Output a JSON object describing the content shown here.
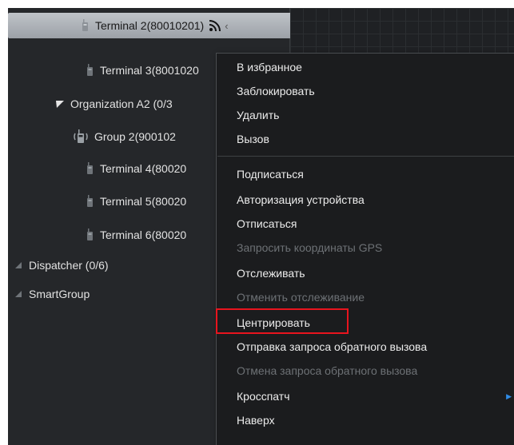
{
  "tree": {
    "items": [
      {
        "label": "Terminal 2(80010201)",
        "type": "terminal",
        "selected": true
      },
      {
        "label": "Terminal 3(8001020",
        "type": "terminal"
      },
      {
        "label": "Organization A2 (0/3",
        "type": "organization",
        "expanded": true
      },
      {
        "label": "Group 2(900102",
        "type": "group"
      },
      {
        "label": "Terminal 4(80020",
        "type": "terminal"
      },
      {
        "label": "Terminal 5(80020",
        "type": "terminal"
      },
      {
        "label": "Terminal 6(80020",
        "type": "terminal"
      },
      {
        "label": "Dispatcher (0/6)",
        "type": "folder"
      },
      {
        "label": "SmartGroup",
        "type": "folder"
      }
    ]
  },
  "context_menu": {
    "items": [
      {
        "label": "В избранное",
        "enabled": true
      },
      {
        "label": "Заблокировать",
        "enabled": true
      },
      {
        "label": "Удалить",
        "enabled": true
      },
      {
        "label": "Вызов",
        "enabled": true
      },
      {
        "label": "Подписаться",
        "enabled": true
      },
      {
        "label": "Авторизация устройства",
        "enabled": true
      },
      {
        "label": "Отписаться",
        "enabled": true
      },
      {
        "label": "Запросить координаты GPS",
        "enabled": false
      },
      {
        "label": "Отслеживать",
        "enabled": true
      },
      {
        "label": "Отменить отслеживание",
        "enabled": false
      },
      {
        "label": "Центрировать",
        "enabled": true,
        "highlighted": true
      },
      {
        "label": "Отправка запроса обратного вызова",
        "enabled": true
      },
      {
        "label": "Отмена запроса обратного вызова",
        "enabled": false
      },
      {
        "label": "Кросспатч",
        "enabled": true,
        "has_submenu": true
      },
      {
        "label": "Наверх",
        "enabled": true
      }
    ],
    "highlight_color": "#e8141e"
  },
  "colors": {
    "background": "#25272a",
    "menu_background": "#1b1c1e",
    "selection": "#b0b4b9",
    "disabled_text": "#6d7175",
    "submenu_arrow": "#2f8be6"
  },
  "icons": {
    "terminal": "radio-handset-icon",
    "group": "group-radio-icon",
    "expand": "triangle-expanded-icon",
    "collapsed": "triangle-collapsed-icon",
    "signal": "rss-signal-icon",
    "submenu": "chevron-right-icon"
  }
}
